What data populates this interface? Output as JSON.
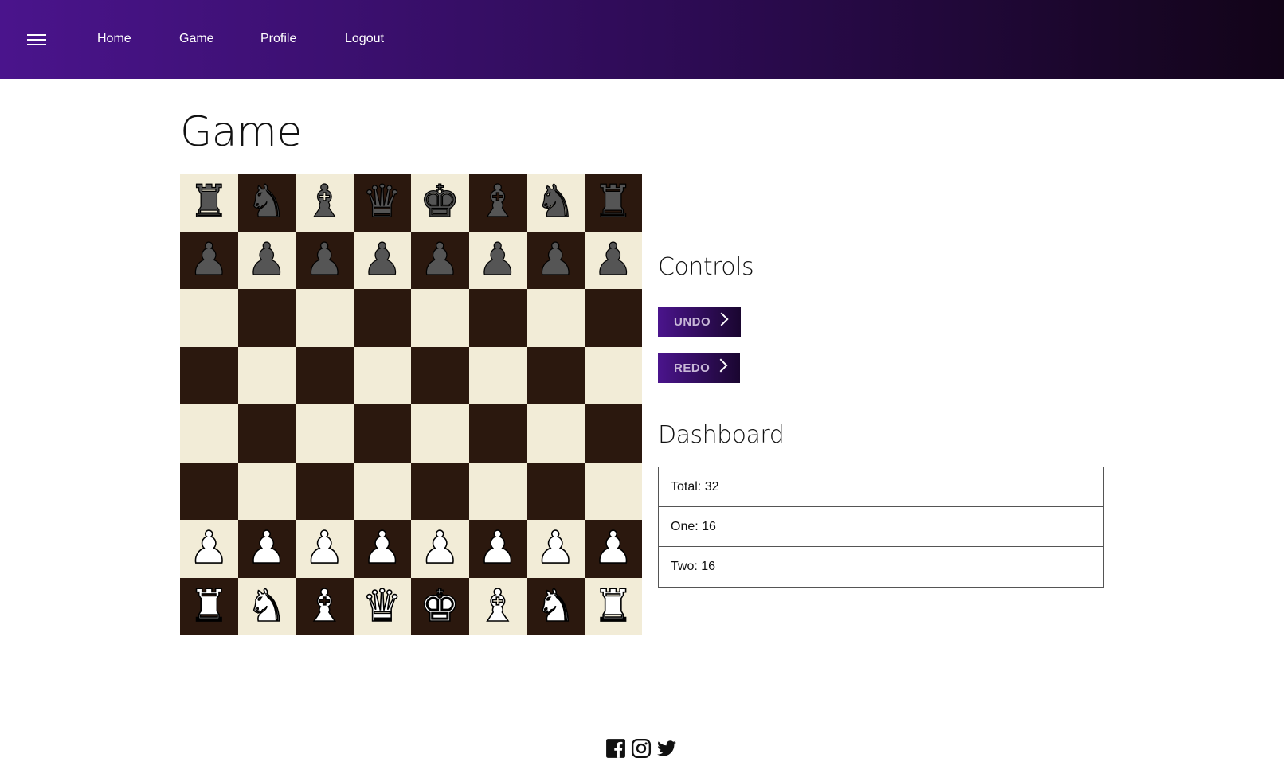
{
  "nav": {
    "menu_icon": "hamburger-menu-icon",
    "links": [
      "Home",
      "Game",
      "Profile",
      "Logout"
    ],
    "gradient": [
      "#4a148c",
      "#120418"
    ]
  },
  "page": {
    "title": "Game"
  },
  "board": {
    "light_color": "#f2ecd7",
    "dark_color": "#2b180e",
    "rows": [
      [
        "br",
        "bn",
        "bb",
        "bq",
        "bk",
        "bb",
        "bn",
        "br"
      ],
      [
        "bp",
        "bp",
        "bp",
        "bp",
        "bp",
        "bp",
        "bp",
        "bp"
      ],
      [
        "",
        "",
        "",
        "",
        "",
        "",
        "",
        ""
      ],
      [
        "",
        "",
        "",
        "",
        "",
        "",
        "",
        ""
      ],
      [
        "",
        "",
        "",
        "",
        "",
        "",
        "",
        ""
      ],
      [
        "",
        "",
        "",
        "",
        "",
        "",
        "",
        ""
      ],
      [
        "wp",
        "wp",
        "wp",
        "wp",
        "wp",
        "wp",
        "wp",
        "wp"
      ],
      [
        "wr",
        "wn",
        "wb",
        "wq",
        "wk",
        "wb",
        "wn",
        "wr"
      ]
    ]
  },
  "controls": {
    "heading": "Controls",
    "undo_label": "UNDO",
    "redo_label": "REDO"
  },
  "dashboard": {
    "heading": "Dashboard",
    "rows": [
      "Total: 32",
      "One: 16",
      "Two: 16"
    ]
  },
  "footer": {
    "icons": [
      "facebook-icon",
      "instagram-icon",
      "twitter-icon"
    ]
  }
}
